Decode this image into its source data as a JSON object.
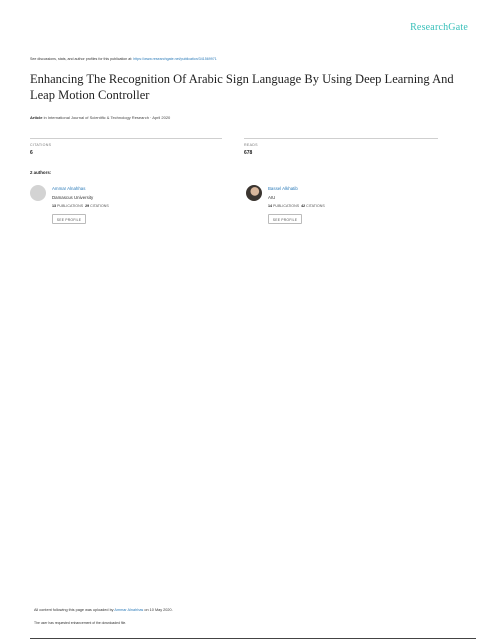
{
  "brand": "ResearchGate",
  "header": {
    "discuss_text": "See discussions, stats, and author profiles for this publication at: ",
    "discuss_url": "https://www.researchgate.net/publication/341569971"
  },
  "paper": {
    "title": "Enhancing The Recognition Of Arabic Sign Language By Using Deep Learning And Leap Motion Controller",
    "type_label": "Article",
    "in_text": "in",
    "venue": "International Journal of Scientific & Technology Research · April 2020"
  },
  "stats": {
    "citations_label": "CITATIONS",
    "citations_value": "6",
    "reads_label": "READS",
    "reads_value": "678"
  },
  "authors": {
    "label": "2 authors:",
    "list": [
      {
        "name": "Ammar Alnahhas",
        "institution": "Damascus University",
        "publications": "13",
        "publications_label": "PUBLICATIONS",
        "citations": "29",
        "citations_label": "CITATIONS",
        "button": "SEE PROFILE"
      },
      {
        "name": "Bassel Alkhatib",
        "institution": "AIU",
        "publications": "14",
        "publications_label": "PUBLICATIONS",
        "citations": "42",
        "citations_label": "CITATIONS",
        "button": "SEE PROFILE"
      }
    ]
  },
  "footer": {
    "upload_prefix": "All content following this page was uploaded by ",
    "uploader": "Ammar Alnahhas",
    "upload_suffix": " on 10 May 2020.",
    "enhancement_note": "The user has requested enhancement of the downloaded file."
  },
  "colors": {
    "brand": "#39c0ba",
    "link": "#2b7bb9"
  }
}
